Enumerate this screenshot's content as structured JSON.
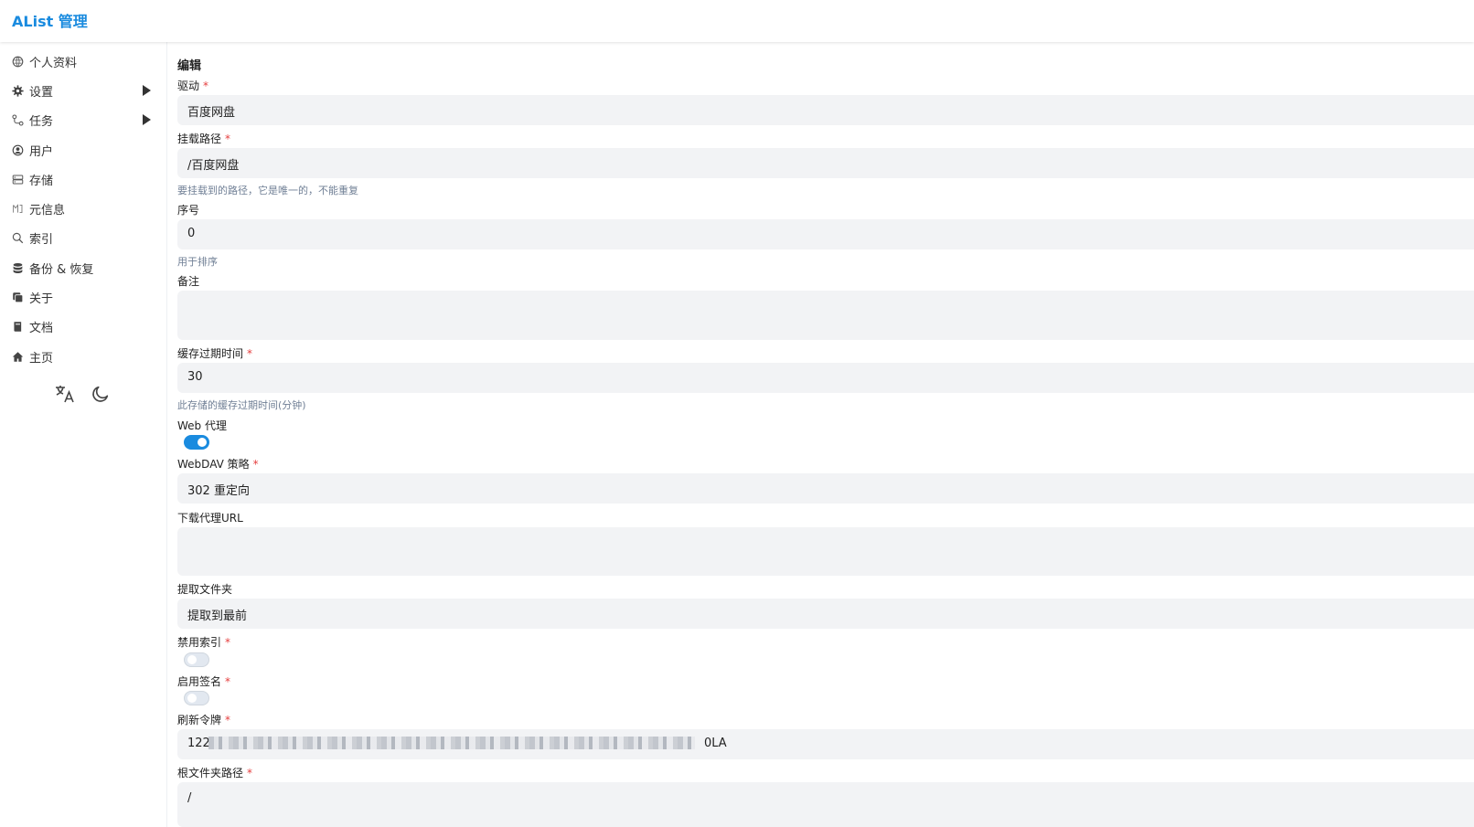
{
  "header": {
    "brand": "AList 管理"
  },
  "sidebar": {
    "items": [
      {
        "label": "个人资料",
        "icon": "profile-icon"
      },
      {
        "label": "设置",
        "icon": "gear-icon"
      },
      {
        "label": "任务",
        "icon": "task-icon"
      },
      {
        "label": "用户",
        "icon": "user-icon"
      },
      {
        "label": "存储",
        "icon": "storage-icon"
      },
      {
        "label": "元信息",
        "icon": "meta-icon"
      },
      {
        "label": "索引",
        "icon": "search-icon"
      },
      {
        "label": "备份 & 恢复",
        "icon": "database-icon"
      },
      {
        "label": "关于",
        "icon": "about-icon"
      },
      {
        "label": "文档",
        "icon": "book-icon"
      },
      {
        "label": "主页",
        "icon": "home-icon"
      }
    ],
    "utilities": [
      "translate-icon",
      "moon-icon"
    ]
  },
  "form": {
    "title": "编辑",
    "required_mark": "*",
    "driver": {
      "label": "驱动",
      "value": "百度网盘"
    },
    "mount_path": {
      "label": "挂载路径",
      "value": "/百度网盘",
      "help": "要挂载到的路径，它是唯一的，不能重复"
    },
    "order": {
      "label": "序号",
      "value": "0",
      "help": "用于排序"
    },
    "remark": {
      "label": "备注",
      "value": ""
    },
    "cache_expiration": {
      "label": "缓存过期时间",
      "value": "30",
      "help": "此存储的缓存过期时间(分钟)"
    },
    "web_proxy": {
      "label": "Web 代理",
      "enabled": true
    },
    "webdav_policy": {
      "label": "WebDAV 策略",
      "value": "302 重定向"
    },
    "download_proxy_url": {
      "label": "下载代理URL",
      "value": ""
    },
    "extract_folder": {
      "label": "提取文件夹",
      "value": "提取到最前"
    },
    "disable_index": {
      "label": "禁用索引",
      "enabled": false
    },
    "enable_sign": {
      "label": "启用签名",
      "enabled": false
    },
    "refresh_token": {
      "label": "刷新令牌",
      "value_start": "122",
      "value_end": "0LA"
    },
    "root_folder_path": {
      "label": "根文件夹路径",
      "value": "/"
    }
  },
  "colors": {
    "accent": "#1a8bdf",
    "field_bg": "#f2f3f5",
    "required": "#e53e3e"
  }
}
